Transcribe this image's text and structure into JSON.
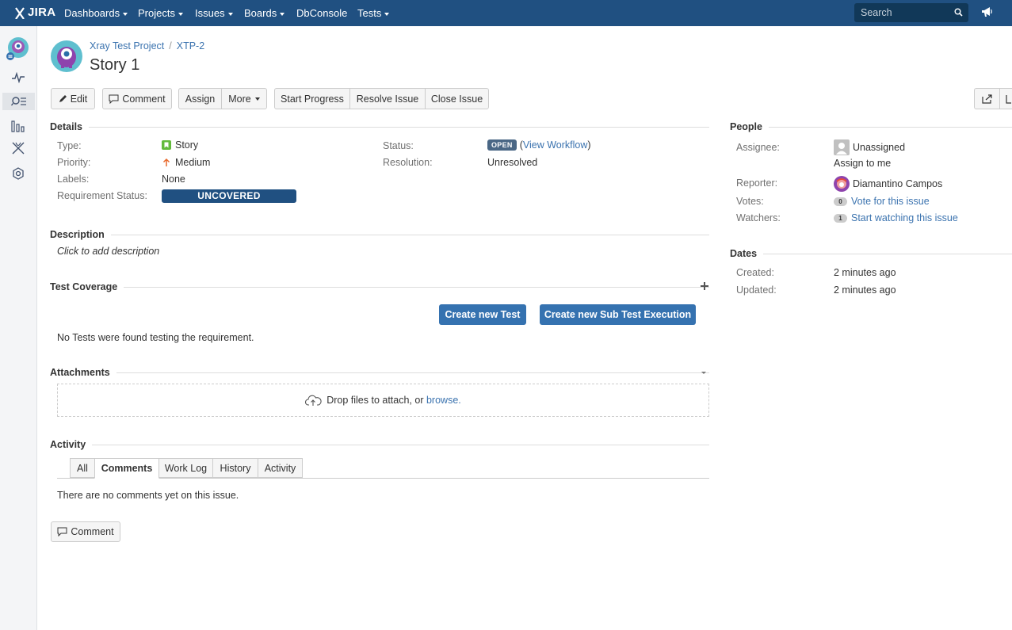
{
  "nav": {
    "logo": "JIRA",
    "items": [
      {
        "label": "Dashboards",
        "dropdown": true
      },
      {
        "label": "Projects",
        "dropdown": true
      },
      {
        "label": "Issues",
        "dropdown": true
      },
      {
        "label": "Boards",
        "dropdown": true
      },
      {
        "label": "DbConsole",
        "dropdown": false
      },
      {
        "label": "Tests",
        "dropdown": true
      }
    ],
    "search_placeholder": "Search"
  },
  "sidebar": {
    "icons": [
      "project-avatar-icon",
      "activity-icon",
      "search-issues-icon",
      "reports-icon",
      "xray-icon",
      "settings-icon"
    ]
  },
  "header": {
    "breadcrumb_project": "Xray Test Project",
    "breadcrumb_sep": "/",
    "breadcrumb_issue": "XTP-2",
    "title": "Story 1"
  },
  "toolbar": {
    "edit": "Edit",
    "comment": "Comment",
    "assign": "Assign",
    "more": "More",
    "start_progress": "Start Progress",
    "resolve_issue": "Resolve Issue",
    "close_issue": "Close Issue"
  },
  "details": {
    "heading": "Details",
    "type_label": "Type:",
    "type_value": "Story",
    "priority_label": "Priority:",
    "priority_value": "Medium",
    "labels_label": "Labels:",
    "labels_value": "None",
    "req_status_label": "Requirement Status:",
    "req_status_value": "UNCOVERED",
    "status_label": "Status:",
    "status_value": "OPEN",
    "view_workflow": "View Workflow",
    "resolution_label": "Resolution:",
    "resolution_value": "Unresolved"
  },
  "description": {
    "heading": "Description",
    "placeholder": "Click to add description"
  },
  "test_coverage": {
    "heading": "Test Coverage",
    "create_test": "Create new Test",
    "create_sub_exec": "Create new Sub Test Execution",
    "empty": "No Tests were found testing the requirement."
  },
  "attachments": {
    "heading": "Attachments",
    "drop_text": "Drop files to attach, or",
    "browse": "browse."
  },
  "activity": {
    "heading": "Activity",
    "tabs": [
      "All",
      "Comments",
      "Work Log",
      "History",
      "Activity"
    ],
    "active_tab": "Comments",
    "empty": "There are no comments yet on this issue.",
    "comment_button": "Comment"
  },
  "people": {
    "heading": "People",
    "assignee_label": "Assignee:",
    "assignee_value": "Unassigned",
    "assign_to_me": "Assign to me",
    "reporter_label": "Reporter:",
    "reporter_value": "Diamantino Campos",
    "votes_label": "Votes:",
    "votes_count": "0",
    "vote_link": "Vote for this issue",
    "watchers_label": "Watchers:",
    "watchers_count": "1",
    "watch_link": "Start watching this issue"
  },
  "dates": {
    "heading": "Dates",
    "created_label": "Created:",
    "created_value": "2 minutes ago",
    "updated_label": "Updated:",
    "updated_value": "2 minutes ago"
  },
  "colors": {
    "nav_bg": "#205081",
    "link": "#3b73af",
    "primary_button": "#3572b0",
    "status_lozenge": "#4a6785",
    "priority_medium": "#e8692c",
    "story_green": "#63ba3c"
  }
}
